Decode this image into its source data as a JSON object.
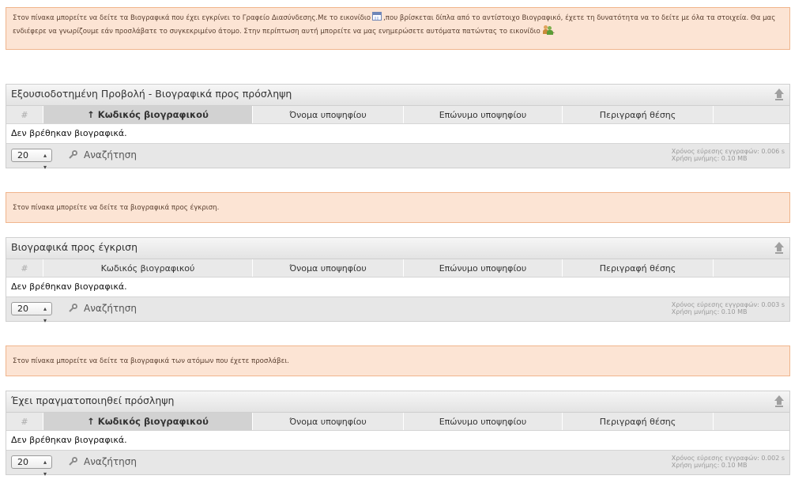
{
  "notices": [
    {
      "text_before": "Στον πίνακα μπορείτε να δείτε τα Βιογραφικά που έχει εγκρίνει το Γραφείο Διασύνδεσης.Με το εικονίδιο",
      "text_middle": ",που βρίσκεται δίπλα από το αντίστοιχο Βιογραφικό, έχετε τη δυνατότητα να το δείτε με όλα τα στοιχεία. Θα μας ενδιέφερε να γνωρίζουμε εάν προσλάβατε το συγκεκριμένο άτομο. Στην περίπτωση αυτή μπορείτε να μας ενημερώσετε αυτόματα πατώντας το εικονίδιο",
      "text_after": "."
    },
    {
      "text": "Στον πίνακα μπορείτε να δείτε τα βιογραφικά προς έγκριση."
    },
    {
      "text": "Στον πίνακα μπορείτε να δείτε τα βιογραφικά των ατόμων που έχετε προσλάβει."
    }
  ],
  "panels": [
    {
      "title": "Εξουσιοδοτημένη Προβολή - Βιογραφικά προς πρόσληψη",
      "columns": {
        "num": "#",
        "code": "↑ Κωδικός βιογραφικού",
        "first": "Όνομα υποψηφίου",
        "last": "Επώνυμο υποψηφίου",
        "desc": "Περιγραφή θέσης"
      },
      "sorted": true,
      "empty": "Δεν βρέθηκαν βιογραφικά.",
      "page_size": "20",
      "search": "Αναζήτηση",
      "time": "Χρόνος εύρεσης εγγραφών: 0.006 s",
      "memory": "Χρήση μνήμης: 0.10 MB"
    },
    {
      "title": "Βιογραφικά προς έγκριση",
      "columns": {
        "num": "#",
        "code": "Κωδικός βιογραφικού",
        "first": "Όνομα υποψηφίου",
        "last": "Επώνυμο υποψηφίου",
        "desc": "Περιγραφή θέσης"
      },
      "sorted": false,
      "empty": "Δεν βρέθηκαν βιογραφικά.",
      "page_size": "20",
      "search": "Αναζήτηση",
      "time": "Χρόνος εύρεσης εγγραφών: 0.003 s",
      "memory": "Χρήση μνήμης: 0.10 MB"
    },
    {
      "title": "Έχει πραγματοποιηθεί πρόσληψη",
      "columns": {
        "num": "#",
        "code": "↑ Κωδικός βιογραφικού",
        "first": "Όνομα υποψηφίου",
        "last": "Επώνυμο υποψηφίου",
        "desc": "Περιγραφή θέσης"
      },
      "sorted": true,
      "empty": "Δεν βρέθηκαν βιογραφικά.",
      "page_size": "20",
      "search": "Αναζήτηση",
      "time": "Χρόνος εύρεσης εγγραφών: 0.002 s",
      "memory": "Χρήση μνήμης: 0.10 MB"
    }
  ],
  "icons": {
    "view": "calendar-icon",
    "hire": "users-icon",
    "collapse": "collapse-up-icon",
    "search": "search-icon",
    "select_arrow": "stepper-arrows-icon"
  },
  "colors": {
    "notice_bg": "#fce4d4",
    "notice_border": "#f0b58d",
    "header_bg": "#e9e9e9",
    "sorted_bg": "#d2d2d2"
  }
}
